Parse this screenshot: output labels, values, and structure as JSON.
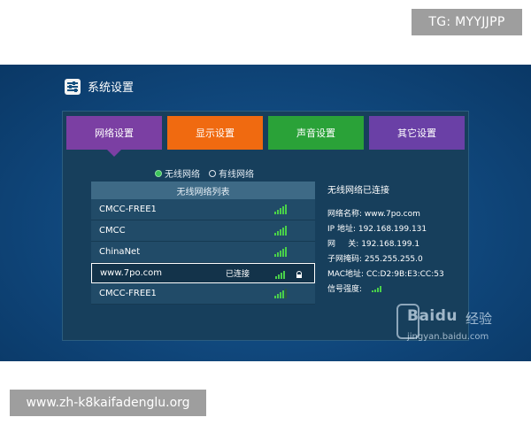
{
  "badges": {
    "top_right": "TG: MYYJJPP",
    "bottom_left": "www.zh-k8kaifadenglu.org"
  },
  "app": {
    "title": "系统设置",
    "icon": "settings-sliders-icon"
  },
  "tabs": [
    {
      "label": "网络设置",
      "color": "#7b3fa3",
      "active": true
    },
    {
      "label": "显示设置",
      "color": "#f06a10",
      "active": false
    },
    {
      "label": "声音设置",
      "color": "#2aa238",
      "active": false
    },
    {
      "label": "其它设置",
      "color": "#6a40a6",
      "active": false
    }
  ],
  "network_type": {
    "options": [
      {
        "label": "无线网络",
        "selected": true
      },
      {
        "label": "有线网络",
        "selected": false
      }
    ]
  },
  "wifi_list": {
    "header": "无线网络列表",
    "items": [
      {
        "ssid": "CMCC-FREE1",
        "status": "",
        "signal": 5,
        "locked": false,
        "selected": false
      },
      {
        "ssid": "CMCC",
        "status": "",
        "signal": 5,
        "locked": false,
        "selected": false
      },
      {
        "ssid": "ChinaNet",
        "status": "",
        "signal": 5,
        "locked": false,
        "selected": false
      },
      {
        "ssid": "www.7po.com",
        "status": "已连接",
        "signal": 4,
        "locked": true,
        "selected": true
      },
      {
        "ssid": "CMCC-FREE1",
        "status": "",
        "signal": 4,
        "locked": false,
        "selected": false
      }
    ]
  },
  "info": {
    "title": "无线网络已连接",
    "lines": [
      {
        "label": "网络名称: ",
        "value": "www.7po.com"
      },
      {
        "label": "IP 地址: ",
        "value": "192.168.199.131"
      },
      {
        "label": "网     关: ",
        "value": "192.168.199.1"
      },
      {
        "label": "子网掩码: ",
        "value": "255.255.255.0"
      },
      {
        "label": "MAC地址: ",
        "value": "CC:D2:9B:E3:CC:53"
      },
      {
        "label": "信号强度: ",
        "value": ""
      }
    ],
    "signal_strength": 4
  },
  "watermark": {
    "brand": "Baidu",
    "sub": "经验",
    "url": "jingyan.baidu.com"
  }
}
